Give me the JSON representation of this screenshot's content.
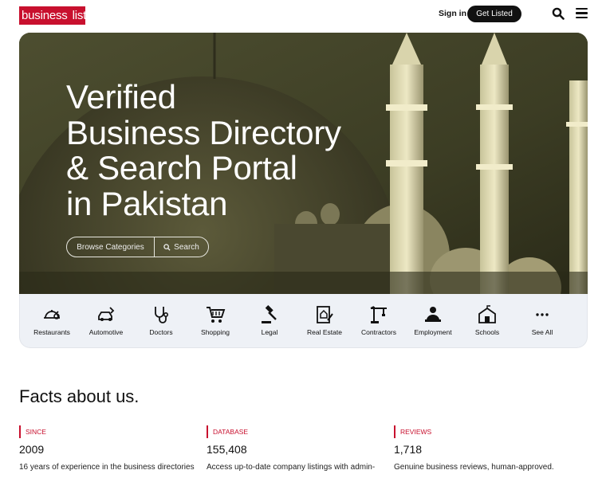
{
  "header": {
    "logo_left": "business",
    "logo_right": "list",
    "signin_label": "Sign in",
    "get_listed_label": "Get Listed"
  },
  "hero": {
    "title_lines": [
      "Verified",
      "Business Directory",
      "& Search Portal",
      "in Pakistan"
    ],
    "browse_label": "Browse Categories",
    "search_label": "Search"
  },
  "categories": [
    {
      "label": "Restaurants",
      "icon": "restaurant-icon"
    },
    {
      "label": "Automotive",
      "icon": "automotive-icon"
    },
    {
      "label": "Doctors",
      "icon": "stethoscope-icon"
    },
    {
      "label": "Shopping",
      "icon": "shopping-cart-icon"
    },
    {
      "label": "Legal",
      "icon": "gavel-icon"
    },
    {
      "label": "Real Estate",
      "icon": "real-estate-icon"
    },
    {
      "label": "Contractors",
      "icon": "crane-icon"
    },
    {
      "label": "Employment",
      "icon": "employee-icon"
    },
    {
      "label": "Schools",
      "icon": "school-icon"
    },
    {
      "label": "See All",
      "icon": "more-icon"
    }
  ],
  "facts": {
    "title": "Facts about us.",
    "items": [
      {
        "tag": "SINCE",
        "value": "2009",
        "desc": "16 years of experience in the business directories"
      },
      {
        "tag": "DATABASE",
        "value": "155,408",
        "desc": "Access up-to-date company listings with admin-"
      },
      {
        "tag": "REVIEWS",
        "value": "1,718",
        "desc": "Genuine business reviews, human-approved."
      }
    ]
  },
  "colors": {
    "brand": "#c8102e",
    "button_dark": "#111111",
    "category_bg": "#eef1f6"
  }
}
